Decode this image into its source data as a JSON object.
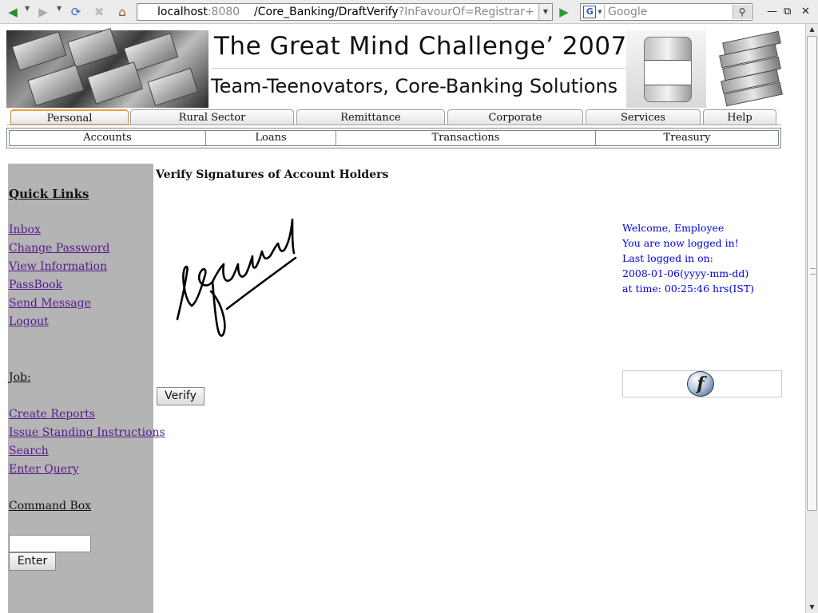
{
  "browser": {
    "url_host": "localhost",
    "url_port": ":8080",
    "url_path_1": "/Core_Banking",
    "url_path_2": "/DraftVerify",
    "url_query": "?InFavourOf=Registrar+ ...",
    "search_placeholder": "Google",
    "search_engine_letter": "G"
  },
  "header": {
    "title": "The Great Mind Challenge’ 2007",
    "subtitle": "Team-Teenovators, Core-Banking Solutions"
  },
  "tabs": [
    {
      "label": "Personal",
      "active": true
    },
    {
      "label": "Rural Sector",
      "active": false
    },
    {
      "label": "Remittance",
      "active": false
    },
    {
      "label": "Corporate",
      "active": false
    },
    {
      "label": "Services",
      "active": false
    },
    {
      "label": "Help",
      "active": false
    }
  ],
  "subnav": [
    "Accounts",
    "Loans",
    "Transactions",
    "Treasury"
  ],
  "sidebar": {
    "quick_links_heading": "Quick Links",
    "quick_links": [
      "Inbox",
      "Change Password",
      "View Information",
      "PassBook",
      "Send Message",
      "Logout"
    ],
    "job_heading": "Job:",
    "job_links": [
      "Create Reports",
      "Issue Standing Instructions",
      "Search",
      "Enter Query"
    ],
    "command_heading": "Command Box",
    "command_value": "",
    "enter_label": "Enter"
  },
  "main": {
    "title": "Verify Signatures of Account Holders",
    "signature_text": "Gaurav",
    "verify_label": "Verify"
  },
  "welcome": {
    "line1": "Welcome, Employee",
    "line2": "You are now logged in!",
    "line3": "Last logged in on:",
    "line4": "2008-01-06(yyyy-mm-dd)",
    "line5": "at time: 00:25:46 hrs(IST)"
  },
  "colors": {
    "link": "#551a8b",
    "welcome_text": "#0000dd",
    "sidebar_bg": "#b4b4b4",
    "active_tab_accent": "#f0b44a"
  }
}
